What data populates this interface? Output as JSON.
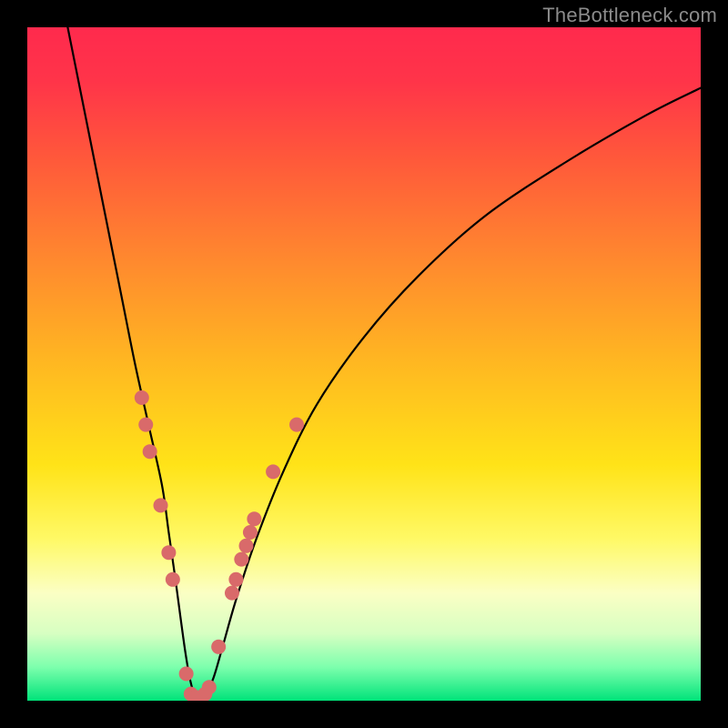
{
  "watermark": {
    "text": "TheBottleneck.com"
  },
  "chart_data": {
    "type": "line",
    "title": "",
    "xlabel": "",
    "ylabel": "",
    "xlim": [
      0,
      100
    ],
    "ylim": [
      0,
      100
    ],
    "background_gradient": {
      "stops": [
        {
          "offset": 0.0,
          "color": "#ff2a4d"
        },
        {
          "offset": 0.08,
          "color": "#ff3449"
        },
        {
          "offset": 0.2,
          "color": "#ff5a3a"
        },
        {
          "offset": 0.35,
          "color": "#ff8a2e"
        },
        {
          "offset": 0.5,
          "color": "#ffb821"
        },
        {
          "offset": 0.65,
          "color": "#ffe318"
        },
        {
          "offset": 0.76,
          "color": "#fff966"
        },
        {
          "offset": 0.84,
          "color": "#fbffc4"
        },
        {
          "offset": 0.9,
          "color": "#d7ffc2"
        },
        {
          "offset": 0.95,
          "color": "#7dffad"
        },
        {
          "offset": 1.0,
          "color": "#00e37a"
        }
      ]
    },
    "series": [
      {
        "name": "bottleneck-curve",
        "color": "#000000",
        "x": [
          6,
          8,
          10,
          12,
          14,
          16,
          18,
          20,
          21,
          22,
          22.8,
          23.5,
          24.2,
          25,
          26,
          27.5,
          29,
          31,
          34,
          38,
          43,
          50,
          58,
          68,
          80,
          92,
          100
        ],
        "y": [
          100,
          90,
          80,
          70,
          60,
          50,
          41,
          32,
          25,
          18,
          12,
          7,
          3,
          0.5,
          0.5,
          3,
          8,
          15,
          24,
          34,
          44,
          54,
          63,
          72,
          80,
          87,
          91
        ]
      }
    ],
    "markers": {
      "name": "highlight-points",
      "color": "#d96a6a",
      "radius": 8,
      "points": [
        {
          "x": 17.0,
          "y": 45
        },
        {
          "x": 17.6,
          "y": 41
        },
        {
          "x": 18.2,
          "y": 37
        },
        {
          "x": 19.8,
          "y": 29
        },
        {
          "x": 21.0,
          "y": 22
        },
        {
          "x": 21.6,
          "y": 18
        },
        {
          "x": 23.6,
          "y": 4
        },
        {
          "x": 24.3,
          "y": 1
        },
        {
          "x": 25.0,
          "y": 0.5
        },
        {
          "x": 25.7,
          "y": 0.5
        },
        {
          "x": 26.4,
          "y": 1
        },
        {
          "x": 27.0,
          "y": 2
        },
        {
          "x": 28.4,
          "y": 8
        },
        {
          "x": 30.4,
          "y": 16
        },
        {
          "x": 31.0,
          "y": 18
        },
        {
          "x": 31.8,
          "y": 21
        },
        {
          "x": 32.5,
          "y": 23
        },
        {
          "x": 33.1,
          "y": 25
        },
        {
          "x": 33.7,
          "y": 27
        },
        {
          "x": 36.5,
          "y": 34
        },
        {
          "x": 40.0,
          "y": 41
        }
      ]
    }
  }
}
